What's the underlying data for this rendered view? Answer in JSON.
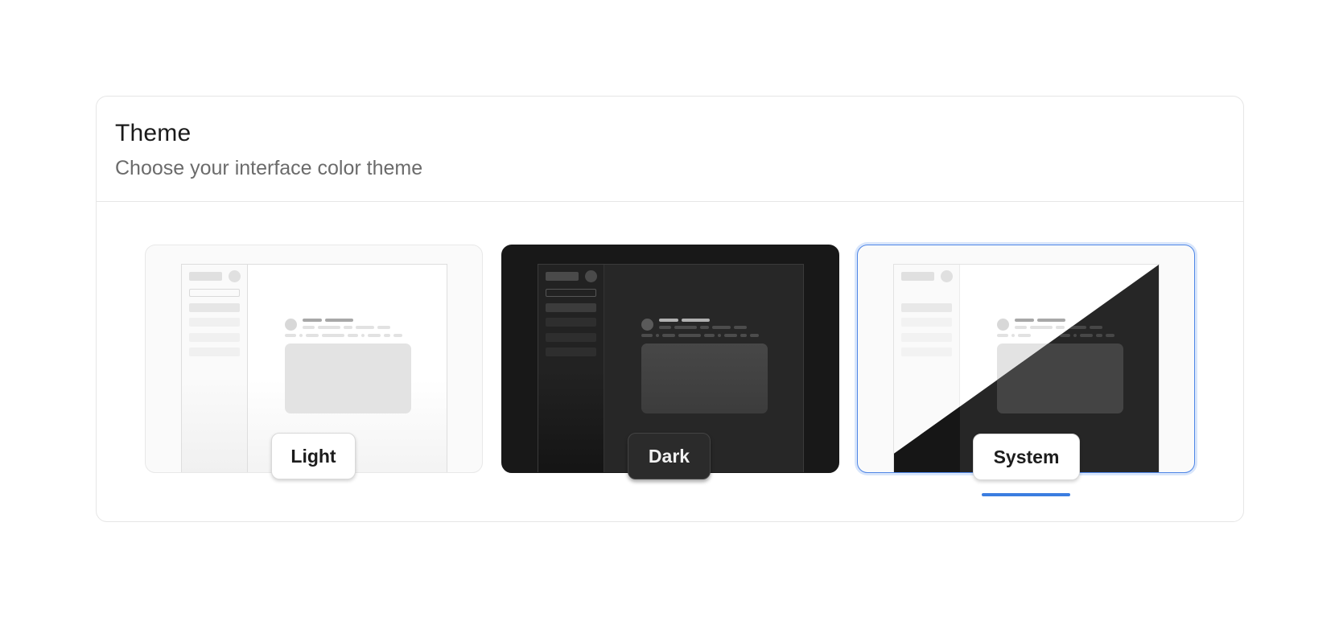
{
  "header": {
    "title": "Theme",
    "subtitle": "Choose your interface color theme"
  },
  "options": [
    {
      "id": "light",
      "label": "Light",
      "selected": false
    },
    {
      "id": "dark",
      "label": "Dark",
      "selected": false
    },
    {
      "id": "system",
      "label": "System",
      "selected": true
    }
  ],
  "colors": {
    "accent": "#3b7de0",
    "selected_border": "#4f86e6",
    "dark_bg": "#181818"
  }
}
